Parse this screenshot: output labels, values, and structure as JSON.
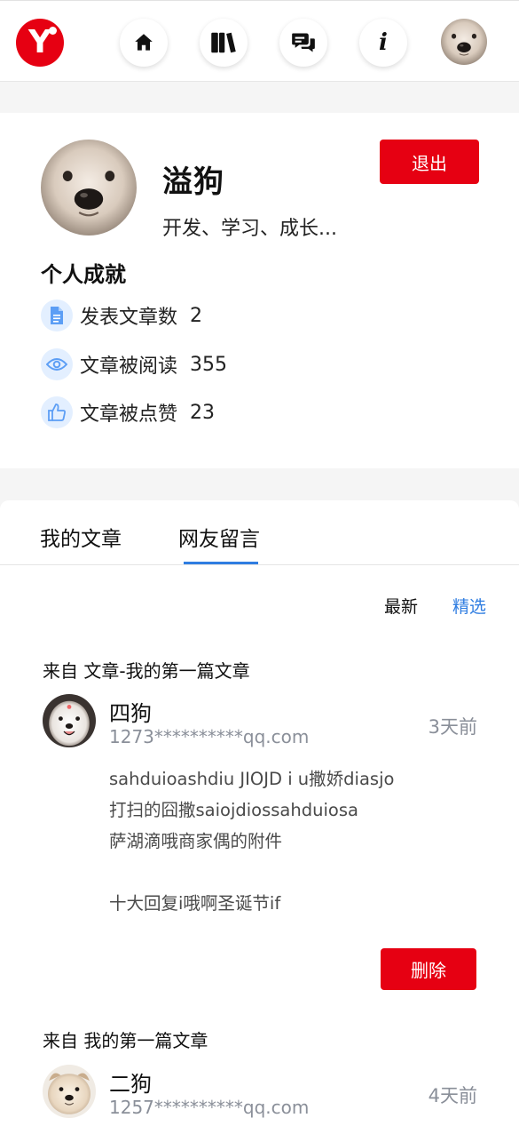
{
  "header": {
    "logo_letter": "Y",
    "nav": [
      {
        "icon": "home-icon"
      },
      {
        "icon": "book-icon"
      },
      {
        "icon": "chat-icon"
      },
      {
        "icon": "info-icon",
        "glyph": "i"
      }
    ],
    "accent": "#e60012"
  },
  "profile": {
    "name": "溢狗",
    "motto": "开发、学习、成长...",
    "logout_label": "退出",
    "achievements_title": "个人成就",
    "stats": [
      {
        "icon": "document-icon",
        "label": "发表文章数",
        "value": "2"
      },
      {
        "icon": "eye-icon",
        "label": "文章被阅读",
        "value": "355"
      },
      {
        "icon": "thumbs-up-icon",
        "label": "文章被点赞",
        "value": "23"
      }
    ]
  },
  "tabs": [
    {
      "label": "我的文章",
      "active": false
    },
    {
      "label": "网友留言",
      "active": true
    }
  ],
  "sort": {
    "latest": "最新",
    "featured": "精选",
    "active_color": "#2f7de1"
  },
  "comments": [
    {
      "from": "来自 文章-我的第一篇文章",
      "name": "四狗",
      "email": "1273**********qq.com",
      "time": "3天前",
      "lines": [
        "sahduioashdiu JIOJD i u撒娇diasjo",
        "打扫的囧撒saiojdiossahduiosa",
        "萨湖滴哦商家偶的附件",
        "",
        "十大回复i哦啊圣诞节if"
      ],
      "delete_label": "删除"
    },
    {
      "from": "来自 我的第一篇文章",
      "name": "二狗",
      "email": "1257**********qq.com",
      "time": "4天前"
    }
  ]
}
